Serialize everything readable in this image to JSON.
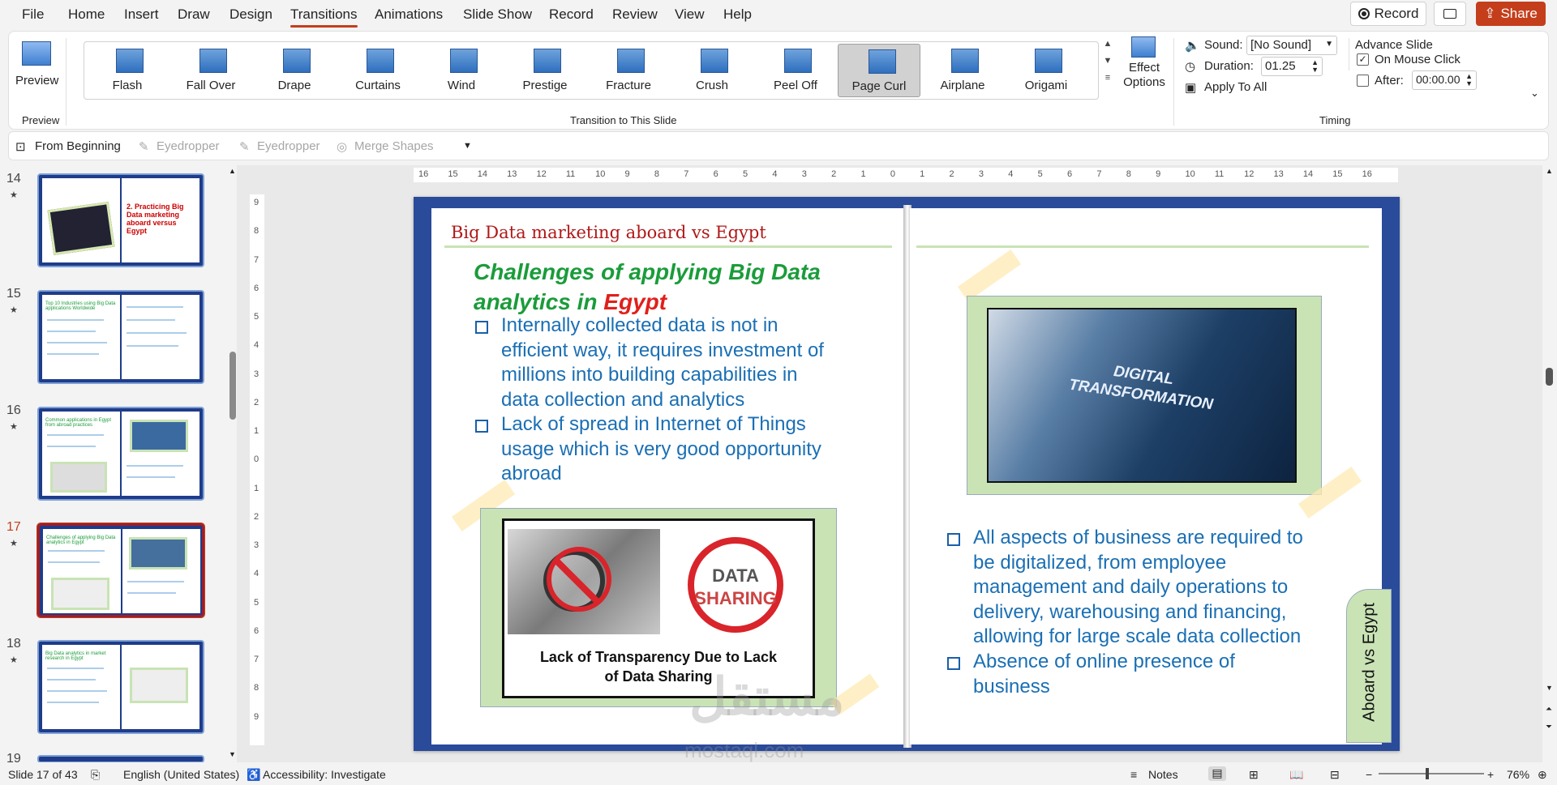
{
  "menu": {
    "items": [
      "File",
      "Home",
      "Insert",
      "Draw",
      "Design",
      "Transitions",
      "Animations",
      "Slide Show",
      "Record",
      "Review",
      "View",
      "Help"
    ],
    "active": "Transitions",
    "record_label": "Record",
    "share_label": "Share"
  },
  "ribbon": {
    "preview_label": "Preview",
    "preview_group": "Preview",
    "transition_group": "Transition to This Slide",
    "transitions": [
      "Flash",
      "Fall Over",
      "Drape",
      "Curtains",
      "Wind",
      "Prestige",
      "Fracture",
      "Crush",
      "Peel Off",
      "Page Curl",
      "Airplane",
      "Origami"
    ],
    "selected_transition": "Page Curl",
    "effect_options_line1": "Effect",
    "effect_options_line2": "Options",
    "sound_label": "Sound:",
    "sound_value": "[No Sound]",
    "duration_label": "Duration:",
    "duration_value": "01.25",
    "apply_all_label": "Apply To All",
    "advance_label": "Advance Slide",
    "on_mouse_click_label": "On Mouse Click",
    "on_mouse_click_checked": true,
    "after_label": "After:",
    "after_checked": false,
    "after_value": "00:00.00",
    "timing_group": "Timing"
  },
  "qat": {
    "from_beginning": "From Beginning",
    "eyedropper1": "Eyedropper",
    "eyedropper2": "Eyedropper",
    "merge_shapes": "Merge Shapes"
  },
  "thumbnails": [
    {
      "num": "14",
      "title": "2. Practicing Big Data marketing aboard versus Egypt"
    },
    {
      "num": "15",
      "title": "Top 10 Industries using Big Data applications Worldwide"
    },
    {
      "num": "16",
      "title": "Common applications in Egypt from abroad practices"
    },
    {
      "num": "17",
      "title": "Challenges of applying Big Data analytics in Egypt"
    },
    {
      "num": "18",
      "title": "Big Data analytics in market research in Egypt"
    },
    {
      "num": "19",
      "title": ""
    }
  ],
  "active_slide_index": 3,
  "slide": {
    "header": "Big Data marketing aboard vs Egypt",
    "title_part1": "Challenges of applying Big Data",
    "title_part2": "analytics in ",
    "title_highlight": "Egypt",
    "left_bullets": [
      [
        "Internally collected data is not in",
        "efficient way, it requires investment of",
        "millions into building capabilities in",
        "data collection and analytics"
      ],
      [
        "Lack of spread in Internet of Things",
        "usage which is very good opportunity",
        "abroad"
      ]
    ],
    "image_caption_line1": "Lack of Transparency Due to Lack",
    "image_caption_line2": "of Data Sharing",
    "digital_image_text1": "DIGITAL",
    "digital_image_text2": "TRANSFORMATION",
    "data_sharing_text1": "DATA",
    "data_sharing_text2": "SHARING",
    "right_bullets": [
      [
        "All aspects of business are required to",
        "be digitalized, from employee",
        "management and daily operations to",
        "delivery, warehousing and financing,",
        "allowing for large scale data collection"
      ],
      [
        "Absence of online presence of",
        "business"
      ]
    ],
    "side_tab": "Aboard vs Egypt",
    "watermark": "مستقل",
    "watermark_url": "mostaql.com"
  },
  "ruler": {
    "h_ticks": [
      "16",
      "15",
      "14",
      "13",
      "12",
      "11",
      "10",
      "9",
      "8",
      "7",
      "6",
      "5",
      "4",
      "3",
      "2",
      "1",
      "0",
      "1",
      "2",
      "3",
      "4",
      "5",
      "6",
      "7",
      "8",
      "9",
      "10",
      "11",
      "12",
      "13",
      "14",
      "15",
      "16"
    ],
    "v_ticks": [
      "9",
      "8",
      "7",
      "6",
      "5",
      "4",
      "3",
      "2",
      "1",
      "0",
      "1",
      "2",
      "3",
      "4",
      "5",
      "6",
      "7",
      "8",
      "9"
    ]
  },
  "status": {
    "slide_info": "Slide 17 of 43",
    "language": "English (United States)",
    "accessibility": "Accessibility: Investigate",
    "notes": "Notes",
    "zoom": "76%"
  },
  "colors": {
    "accent": "#c43e1c",
    "slide_bg": "#2a4a9a",
    "title_green": "#1a9c3a",
    "egypt_red": "#e0201c",
    "bullet_blue": "#1a6fb4",
    "header_red": "#b01818",
    "frame_green": "#c9e3b5"
  }
}
